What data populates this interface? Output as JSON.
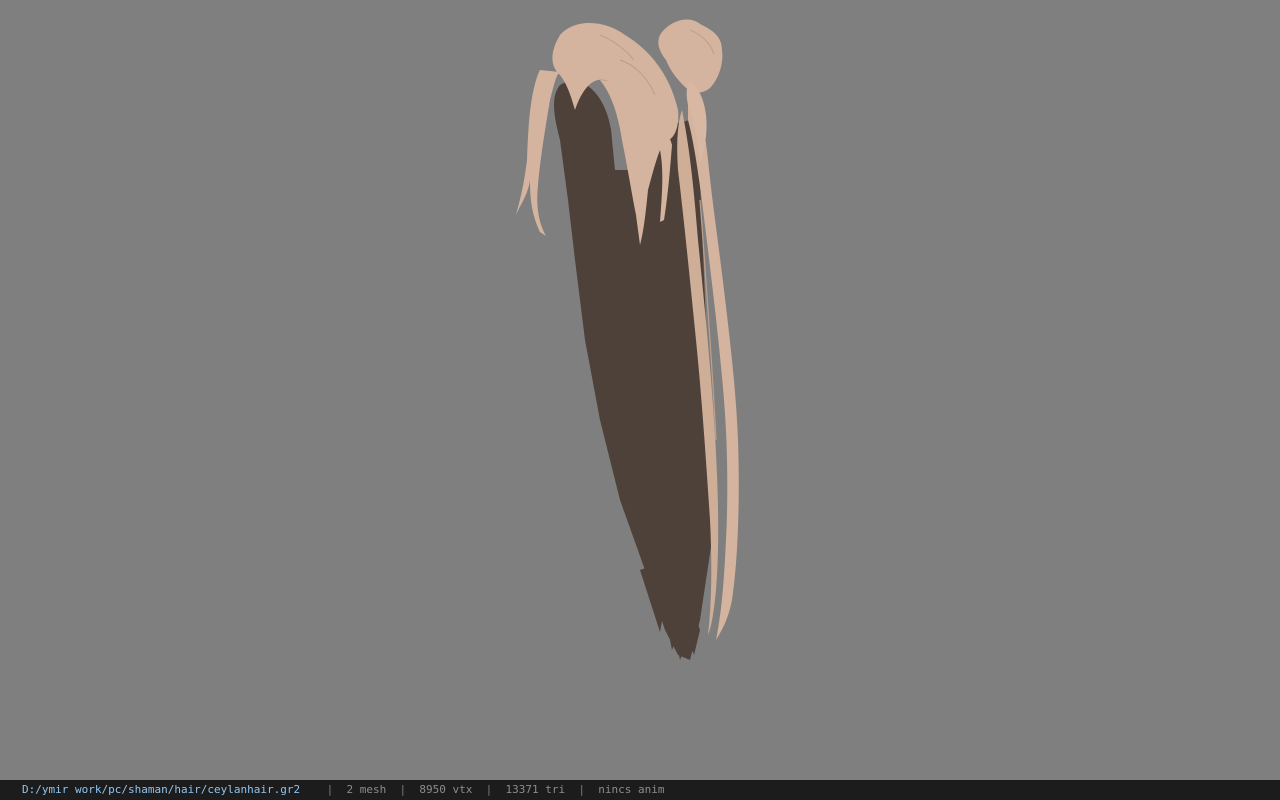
{
  "status_bar": {
    "file_path": "D:/ymir work/pc/shaman/hair/ceylanhair.gr2",
    "separator": "|",
    "mesh_count": "2 mesh",
    "vertex_count": "8950 vtx",
    "triangle_count": "13371 tri",
    "anim_status": "nincs anim"
  },
  "model": {
    "hair_color": "#d5b49f",
    "shadow_color": "#4e413a"
  },
  "colors": {
    "viewport_background": "#7f7f7f",
    "status_background": "#1c1c1c",
    "path_text": "#8fc3f0"
  }
}
